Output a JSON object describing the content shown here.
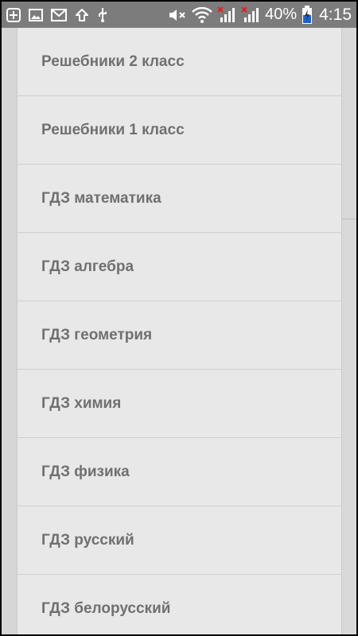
{
  "status_bar": {
    "battery_text": "40%",
    "clock": "4:15",
    "icons_left": [
      "plus-box-icon",
      "image-icon",
      "mail-icon",
      "upload-arrow-icon",
      "usb-icon"
    ],
    "icons_right": [
      "mute-icon",
      "wifi-icon",
      "signal-no-sim-icon-1",
      "signal-no-sim-icon-2",
      "battery-charging-icon"
    ]
  },
  "menu": {
    "items": [
      {
        "label": "Решебники 2 класс"
      },
      {
        "label": "Решебники 1 класс"
      },
      {
        "label": "ГДЗ математика"
      },
      {
        "label": "ГДЗ алгебра"
      },
      {
        "label": "ГДЗ геометрия"
      },
      {
        "label": "ГДЗ химия"
      },
      {
        "label": "ГДЗ физика"
      },
      {
        "label": "ГДЗ русский"
      },
      {
        "label": "ГДЗ белорусский"
      }
    ]
  },
  "colors": {
    "status_bar_bg": "#7c7c7c",
    "drawer_bg": "#e8e8e8",
    "label_text": "#707070",
    "divider": "#cfcfcf"
  }
}
